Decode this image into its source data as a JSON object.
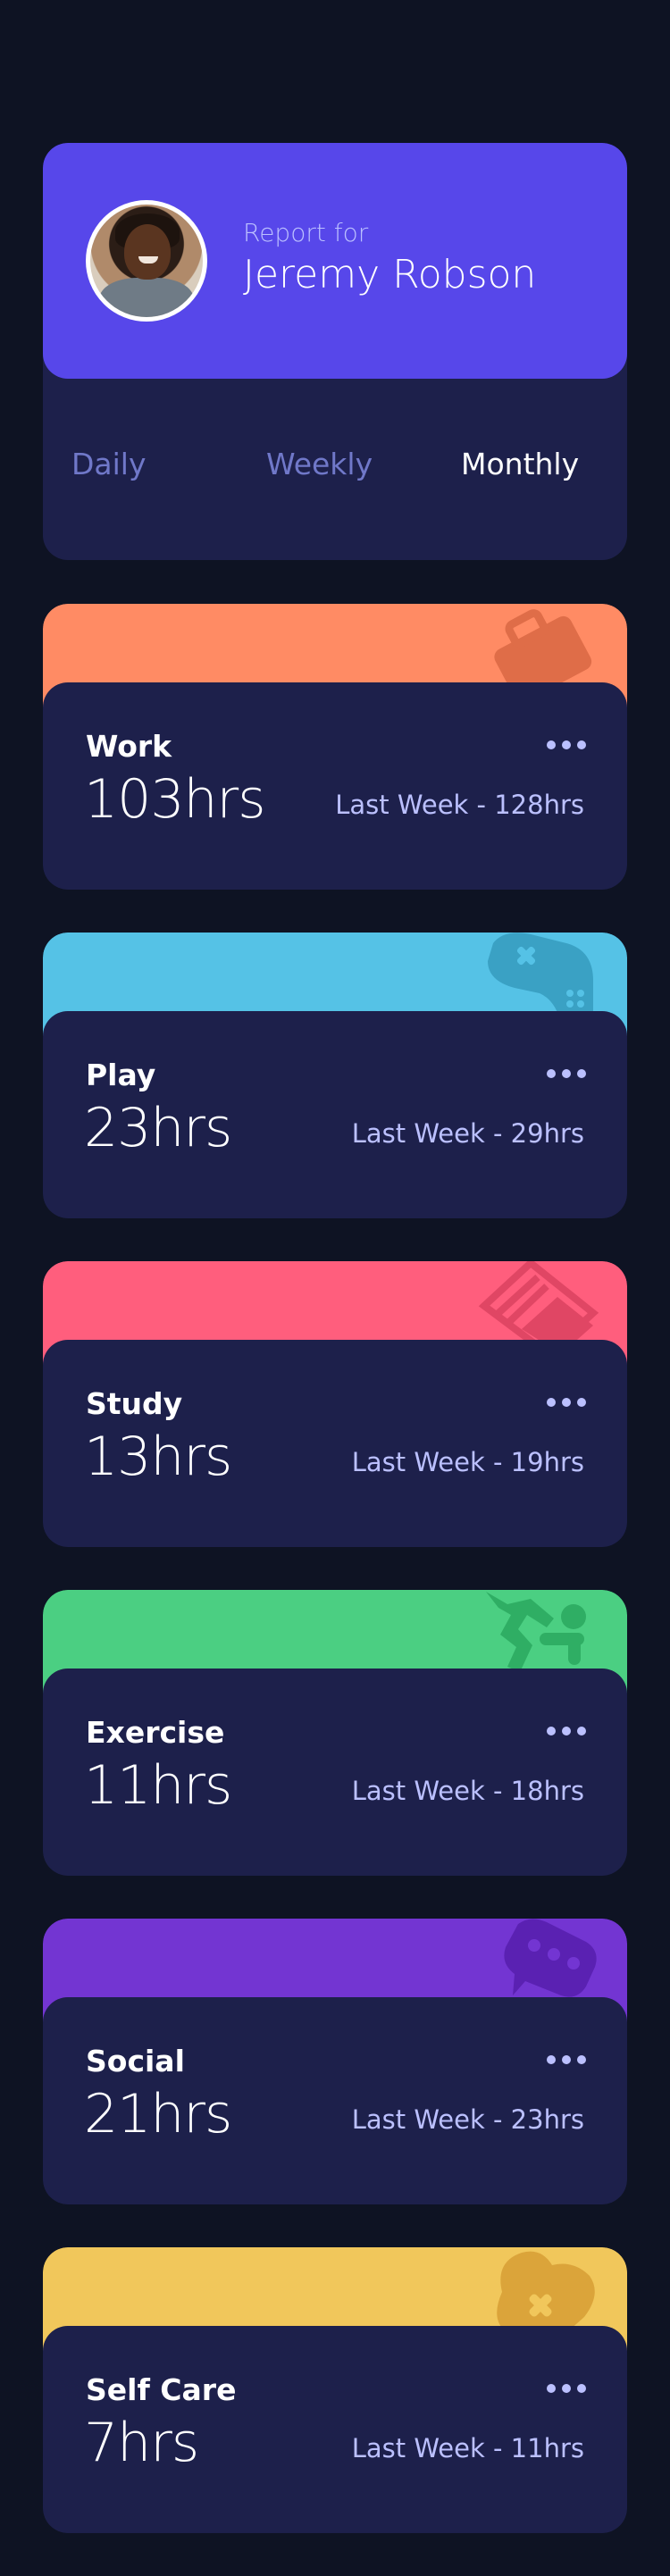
{
  "profile": {
    "report_for": "Report for",
    "name": "Jeremy Robson",
    "accent_color": "#5747ea"
  },
  "tabs": [
    {
      "label": "Daily",
      "active": false
    },
    {
      "label": "Weekly",
      "active": false
    },
    {
      "label": "Monthly",
      "active": true
    }
  ],
  "activities": [
    {
      "title": "Work",
      "hours": "103hrs",
      "last_week": "Last Week - 128hrs",
      "color": "#ff8b64",
      "icon": "briefcase-icon"
    },
    {
      "title": "Play",
      "hours": "23hrs",
      "last_week": "Last Week - 29hrs",
      "color": "#55c2e6",
      "icon": "gamepad-icon"
    },
    {
      "title": "Study",
      "hours": "13hrs",
      "last_week": "Last Week - 19hrs",
      "color": "#ff5e7d",
      "icon": "book-icon"
    },
    {
      "title": "Exercise",
      "hours": "11hrs",
      "last_week": "Last Week - 18hrs",
      "color": "#4bcf82",
      "icon": "runner-icon"
    },
    {
      "title": "Social",
      "hours": "21hrs",
      "last_week": "Last Week - 23hrs",
      "color": "#7335d2",
      "icon": "chat-icon"
    },
    {
      "title": "Self Care",
      "hours": "7hrs",
      "last_week": "Last Week - 11hrs",
      "color": "#f1c75b",
      "icon": "heart-icon"
    }
  ]
}
